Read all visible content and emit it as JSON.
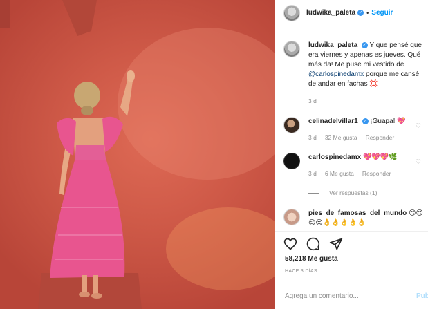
{
  "post": {
    "username": "ludwika_paleta",
    "follow_label": "Seguir",
    "caption_mention": "@carlospinedamx",
    "caption_before": "Y que pensé que era viernes y apenas es jueves. Qué más da! Me puse mi vestido de",
    "caption_after": "porque me cansé de andar en fachas 💢",
    "caption_time": "3 d"
  },
  "comments": [
    {
      "author": "celinadelvillar1",
      "text": "¡Guapa! 💖",
      "time": "3 d",
      "likes": "32 Me gusta",
      "reply": "Responder"
    },
    {
      "author": "carlospinedamx",
      "text": "💖💖💖🌿",
      "time": "3 d",
      "likes": "6 Me gusta",
      "reply": "Responder"
    },
    {
      "author": "pies_de_famosas_del_mundo",
      "text": "😍😍😍😍👌👌👌👌👌",
      "time": "",
      "likes": "",
      "reply": ""
    }
  ],
  "replies_label": "Ver respuestas (1)",
  "actions": {
    "like_count": "58,218 Me gusta",
    "posted_ago": "HACE 3 DÍAS",
    "comment_placeholder": "Agrega un comentario...",
    "publish_label": "Pub"
  },
  "icons": {
    "like": "heart-icon",
    "comment": "comment-bubble-icon",
    "share": "share-paper-plane-icon",
    "verified": "verified-badge-icon"
  },
  "colors": {
    "accent": "#0095f6",
    "verified": "#3897f0",
    "muted": "#8e8e8e",
    "wall": "#cf5a48",
    "dress": "#e8558f"
  }
}
